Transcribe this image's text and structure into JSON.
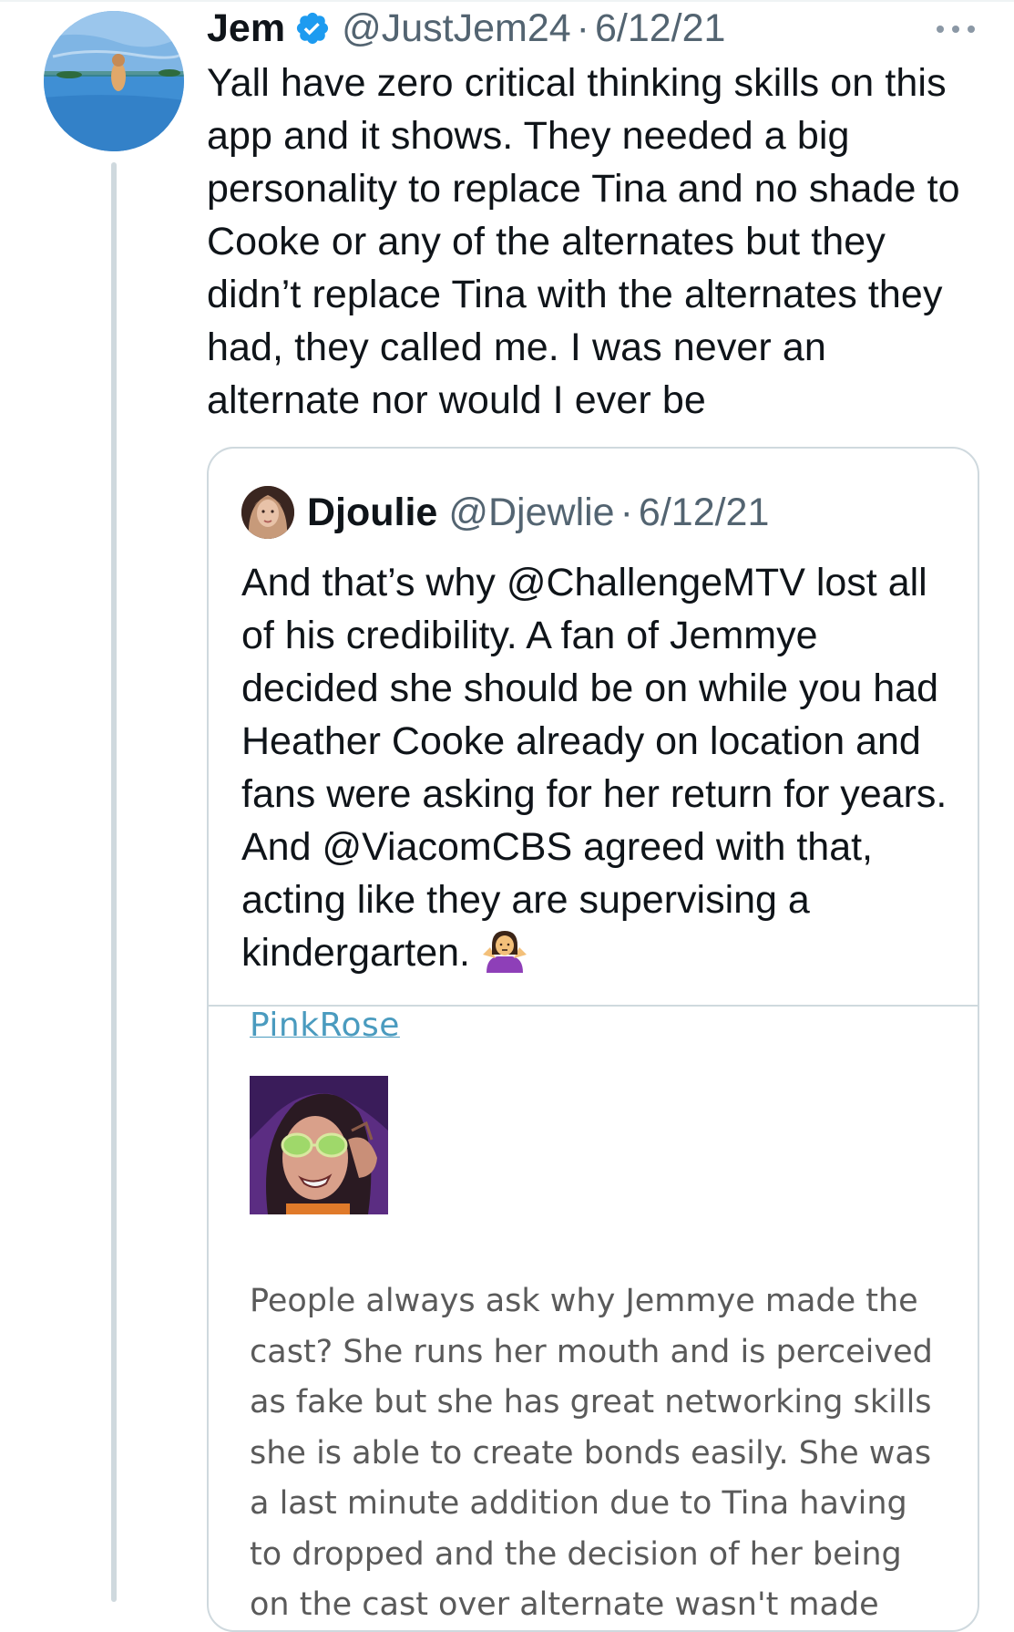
{
  "tweet": {
    "author_name": "Jem",
    "handle": "@JustJem24",
    "separator": "·",
    "date": "6/12/21",
    "text": "Yall have zero critical thinking skills on this app and it shows. They needed a big personality to replace Tina and no shade to Cooke or any of the alternates but they didn’t replace Tina with the alternates they had, they called me. I was never an alternate nor would I ever be",
    "icons": {
      "verified": "verified-badge-icon",
      "more": "more-options-icon"
    }
  },
  "quoted_tweet": {
    "author_name": "Djoulie",
    "handle": "@Djewlie",
    "separator": "·",
    "date": "6/12/21",
    "text": "And that’s why @ChallengeMTV lost all of his credibility. A fan of Jemmye decided she should be on while you had Heather Cooke already on location and fans were asking for her return for years. And @ViacomCBS agreed with that, acting like they are supervising a kindergarten.",
    "emoji": "person-shrugging-emoji"
  },
  "attached_image": {
    "username": "PinkRose",
    "text": "People always ask why Jemmye made the cast?  She runs her mouth and is perceived as fake but she has great networking skills she is able to create bonds easily. She was a last minute addition due to Tina having to dropped and the decision of her being on the cast over alternate  wasn't made until they"
  },
  "colors": {
    "text_primary": "#0f1419",
    "text_secondary": "#536471",
    "border": "#cfd9de",
    "verified_blue": "#1d9bf0",
    "link_teal": "#4a9bbf"
  }
}
